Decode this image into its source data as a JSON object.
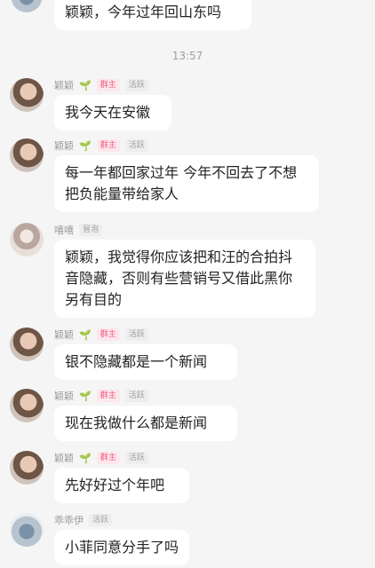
{
  "timestamp": "13:57",
  "top_message": {
    "text": "颖颖，今年过年回山东吗"
  },
  "messages": [
    {
      "name": "颖颖",
      "badges": [
        "群主",
        "活跃"
      ],
      "text": "我今天在安徽"
    },
    {
      "name": "颖颖",
      "badges": [
        "群主",
        "活跃"
      ],
      "text": "每一年都回家过年 今年不回去了不想把负能量带给家人"
    },
    {
      "name": "嘻嘻",
      "badges": [
        "冒泡"
      ],
      "text": "颖颖，我觉得你应该把和汪的合拍抖音隐藏，否则有些营销号又借此黑你另有目的"
    },
    {
      "name": "颖颖",
      "badges": [
        "群主",
        "活跃"
      ],
      "text": "银不隐藏都是一个新闻"
    },
    {
      "name": "颖颖",
      "badges": [
        "群主",
        "活跃"
      ],
      "text": "现在我做什么都是新闻"
    },
    {
      "name": "颖颖",
      "badges": [
        "群主",
        "活跃"
      ],
      "text": "先好好过个年吧"
    },
    {
      "name": "乖乖伊",
      "badges": [
        "活跃"
      ],
      "text": "小菲同意分手了吗"
    }
  ],
  "colors": {
    "owner_badge": "#f25b7f",
    "background": "#f5f5f5",
    "bubble": "#ffffff"
  },
  "icons": {
    "sprout": "sprout-icon"
  }
}
